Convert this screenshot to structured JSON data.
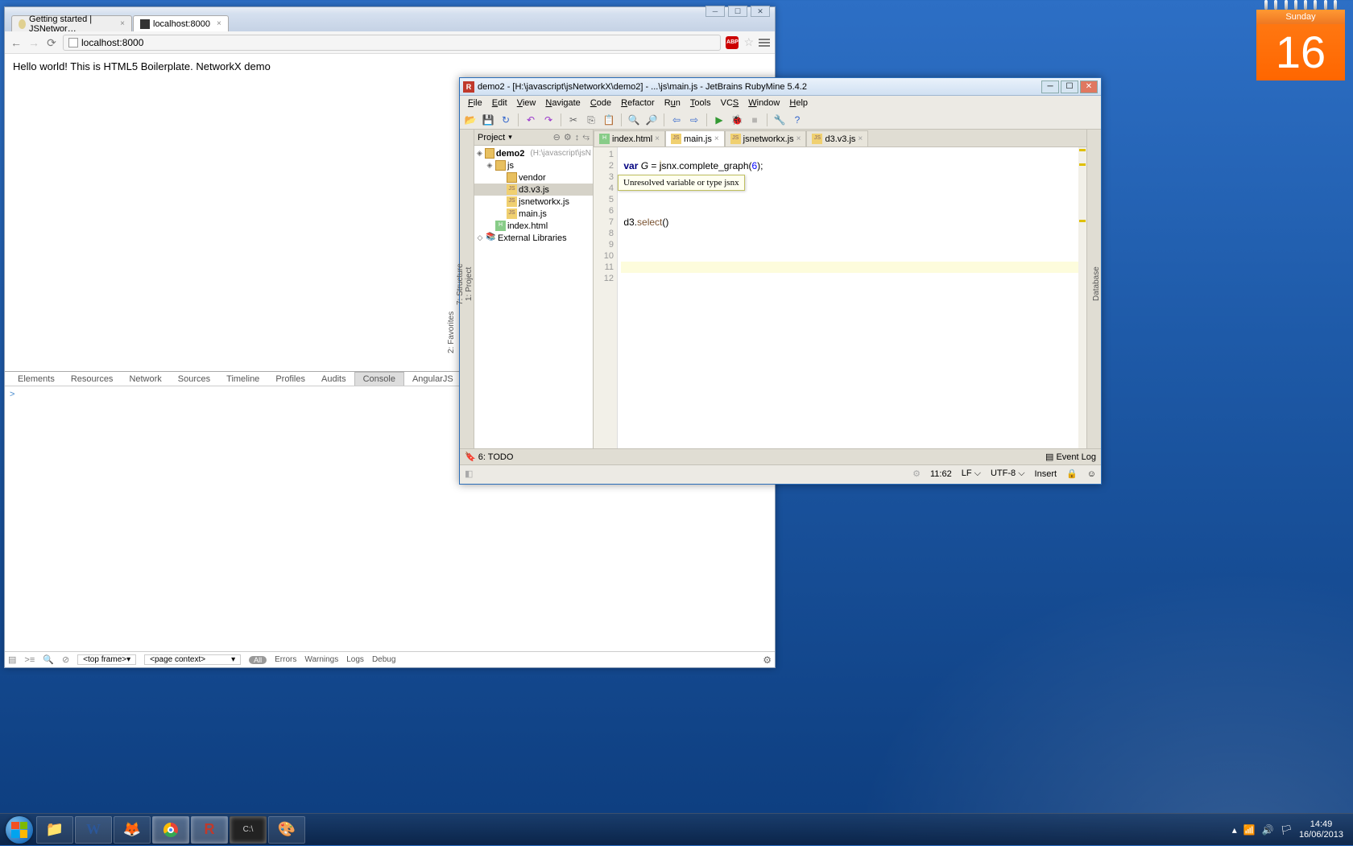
{
  "chrome": {
    "tabs": [
      {
        "title": "Getting started | JSNetwor…",
        "active": false
      },
      {
        "title": "localhost:8000",
        "active": true
      }
    ],
    "url": "localhost:8000",
    "page_text": "Hello world! This is HTML5 Boilerplate. NetworkX demo",
    "devtools": {
      "tabs": [
        "Elements",
        "Resources",
        "Network",
        "Sources",
        "Timeline",
        "Profiles",
        "Audits",
        "Console",
        "AngularJS"
      ],
      "active": "Console",
      "prompt": ">",
      "footer": {
        "frame": "<top frame>",
        "context": "<page context>",
        "pill": "All",
        "items": [
          "Errors",
          "Warnings",
          "Logs",
          "Debug"
        ]
      }
    }
  },
  "ide": {
    "title": "demo2 - [H:\\javascript\\jsNetworkX\\demo2] - ...\\js\\main.js - JetBrains RubyMine 5.4.2",
    "menus": [
      "File",
      "Edit",
      "View",
      "Navigate",
      "Code",
      "Refactor",
      "Run",
      "Tools",
      "VCS",
      "Window",
      "Help"
    ],
    "proj_header": "Project",
    "tree": {
      "root": "demo2",
      "root_hint": "(H:\\javascript\\jsN",
      "js": "js",
      "vendor": "vendor",
      "d3": "d3.v3.js",
      "jsnet": "jsnetworkx.js",
      "main": "main.js",
      "index": "index.html",
      "ext": "External Libraries"
    },
    "editor_tabs": [
      {
        "name": "index.html",
        "icon": "html"
      },
      {
        "name": "main.js",
        "icon": "js",
        "active": true
      },
      {
        "name": "jsnetworkx.js",
        "icon": "js"
      },
      {
        "name": "d3.v3.js",
        "icon": "js"
      }
    ],
    "code": {
      "l2": "var G = jsnx.complete_graph(6);",
      "l7": "d3.select()",
      "tooltip": "Unresolved variable or type jsnx"
    },
    "bottom": {
      "todo": "6: TODO",
      "eventlog": "Event Log"
    },
    "status": {
      "pos": "11:62",
      "le": "LF",
      "enc": "UTF-8",
      "mode": "Insert"
    },
    "rails": {
      "project": "1: Project",
      "structure": "7: Structure",
      "favorites": "2: Favorites",
      "database": "Database"
    }
  },
  "calendar": {
    "day": "Sunday",
    "date": "16"
  },
  "tray": {
    "time": "14:49",
    "date": "16/06/2013"
  }
}
